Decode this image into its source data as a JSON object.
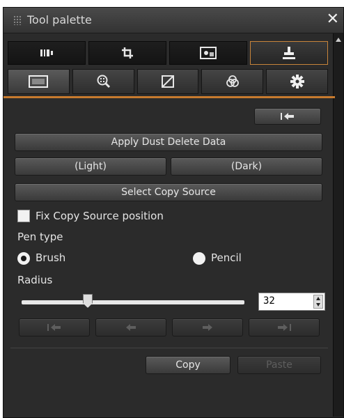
{
  "window": {
    "title": "Tool palette",
    "close_glyph": "✕"
  },
  "main_tabs": [
    {
      "icon": "histogram-icon",
      "active": false
    },
    {
      "icon": "crop-icon",
      "active": false
    },
    {
      "icon": "image-adjust-icon",
      "active": false
    },
    {
      "icon": "stamp-icon",
      "active": true
    }
  ],
  "sub_tabs": [
    {
      "icon": "picture-icon",
      "active": true
    },
    {
      "icon": "zoom-detail-icon",
      "active": false
    },
    {
      "icon": "tone-curve-icon",
      "active": false
    },
    {
      "icon": "color-circles-icon",
      "active": false
    },
    {
      "icon": "gear-icon",
      "active": false
    }
  ],
  "buttons": {
    "undo_all_glyph": "⇤",
    "apply_dust": "Apply Dust Delete Data",
    "light": "(Light)",
    "dark": "(Dark)",
    "select_copy_source": "Select Copy Source",
    "copy": "Copy",
    "paste": "Paste"
  },
  "fix_copy_source": {
    "label": "Fix Copy Source position",
    "checked": false
  },
  "pen_type": {
    "label": "Pen type",
    "options": [
      {
        "label": "Brush",
        "selected": true
      },
      {
        "label": "Pencil",
        "selected": false
      }
    ]
  },
  "radius": {
    "label": "Radius",
    "value": "32",
    "slider_fraction": 0.3
  },
  "history_buttons": [
    "undo-all-icon",
    "undo-icon",
    "redo-icon",
    "redo-all-icon"
  ],
  "colors": {
    "accent": "#c77a2e",
    "background": "#2b2b2b"
  }
}
